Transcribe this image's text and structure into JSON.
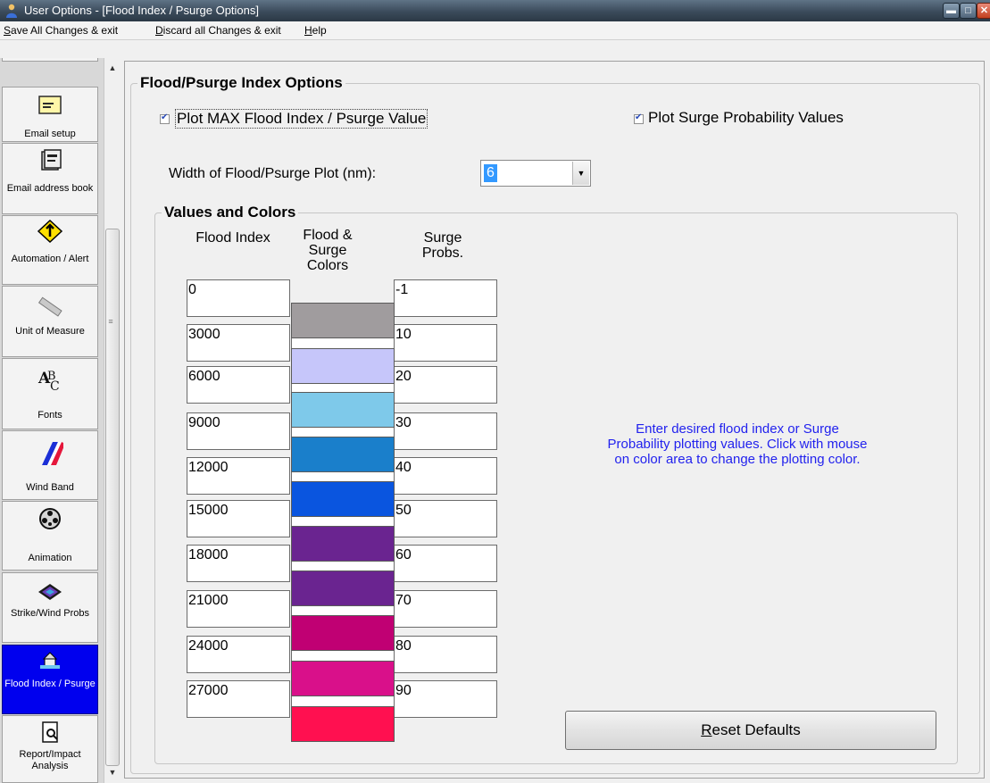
{
  "window": {
    "title": "User Options - [Flood Index / Psurge Options]",
    "min_glyph": "▬",
    "max_glyph": "□",
    "close_glyph": "✕"
  },
  "menu": {
    "save_pre": "S",
    "save_rest": "ave All Changes & exit",
    "discard_pre": "D",
    "discard_rest": "iscard all Changes & exit",
    "help_pre": "H",
    "help_rest": "elp"
  },
  "sidebar": {
    "items": [
      {
        "label": "Email setup",
        "icon": "envelope-icon"
      },
      {
        "label": "Email address book",
        "icon": "address-book-icon"
      },
      {
        "label": "Automation / Alert",
        "icon": "alert-sign-icon"
      },
      {
        "label": "Unit of Measure",
        "icon": "ruler-icon"
      },
      {
        "label": "Fonts",
        "icon": "fonts-icon"
      },
      {
        "label": "Wind Band",
        "icon": "wind-band-icon"
      },
      {
        "label": "Animation",
        "icon": "film-reel-icon"
      },
      {
        "label": "Strike/Wind Probs",
        "icon": "probability-map-icon"
      },
      {
        "label": "Flood Index / Psurge",
        "icon": "flood-house-icon",
        "active": true
      },
      {
        "label": "Report/Impact Analysis",
        "icon": "report-magnifier-icon"
      }
    ],
    "scroll_up_glyph": "▲",
    "scroll_down_glyph": "▼",
    "scroll_grip_glyph": "≡"
  },
  "options": {
    "group_title": "Flood/Psurge Index Options",
    "plot_max_label": "Plot MAX Flood Index / Psurge Value",
    "plot_max_checked": true,
    "plot_surge_label": "Plot Surge Probability Values",
    "plot_surge_checked": true,
    "check_glyph": "✔",
    "width_label": "Width of Flood/Psurge Plot (nm):",
    "width_value": "6",
    "dropdown_glyph": "▼"
  },
  "values": {
    "group_title": "Values and Colors",
    "col_flood": "Flood Index",
    "col_colors": "Flood & Surge Colors",
    "col_surge": "Surge Probs.",
    "flood_index": [
      "0",
      "3000",
      "6000",
      "9000",
      "12000",
      "15000",
      "18000",
      "21000",
      "24000",
      "27000"
    ],
    "surge_probs": [
      "-1",
      "10",
      "20",
      "30",
      "40",
      "50",
      "60",
      "70",
      "80",
      "90"
    ],
    "colors": [
      "#a09c9e",
      "#c6c6fa",
      "#7ec9ea",
      "#1a7fcb",
      "#0a55df",
      "#6a2490",
      "#6a2490",
      "#c00073",
      "#d9108a",
      "#ff1050"
    ],
    "instructions": "Enter desired flood index or Surge Probability plotting values. Click with mouse on color area to change the plotting color.",
    "reset_pre": "R",
    "reset_rest": "eset Defaults"
  }
}
